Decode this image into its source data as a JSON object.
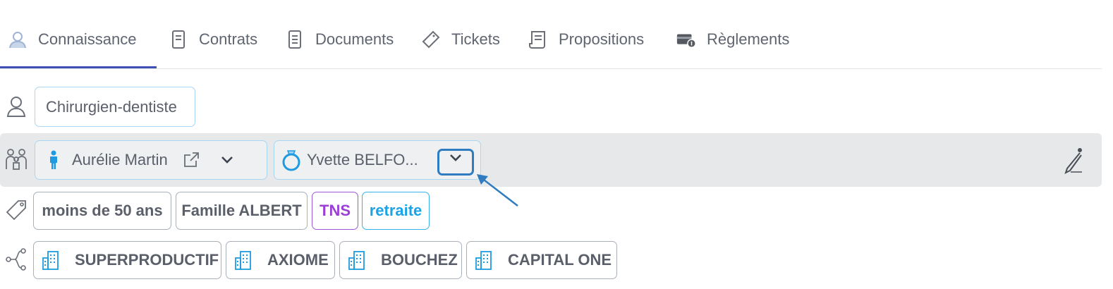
{
  "tabs": [
    {
      "label": "Connaissance",
      "icon": "user-icon",
      "active": true
    },
    {
      "label": "Contrats",
      "icon": "contract-icon"
    },
    {
      "label": "Documents",
      "icon": "document-icon"
    },
    {
      "label": "Tickets",
      "icon": "ticket-icon"
    },
    {
      "label": "Propositions",
      "icon": "proposal-icon"
    },
    {
      "label": "Règlements",
      "icon": "payment-icon"
    }
  ],
  "profession": {
    "icon": "person-outline-icon",
    "value": "Chirurgien-dentiste"
  },
  "relations": {
    "icon": "family-icon",
    "person1": {
      "icon": "person-icon",
      "name": "Aurélie Martin"
    },
    "person2": {
      "icon": "ring-icon",
      "name": "Yvette BELFO..."
    },
    "edit_icon": "pencil-icon"
  },
  "tags": {
    "icon": "tag-icon",
    "items": [
      "moins de 50 ans",
      "Famille ALBERT",
      "TNS",
      "retraite"
    ]
  },
  "companies": {
    "icon": "share-icon",
    "items": [
      "SUPERPRODUCTIF",
      "AXIOME",
      "BOUCHEZ",
      "CAPITAL ONE"
    ]
  },
  "colors": {
    "accent": "#3f51b5",
    "highlight": "#2f7cc0",
    "tns": "#9b3fd6",
    "retraite": "#1aa3e6"
  }
}
